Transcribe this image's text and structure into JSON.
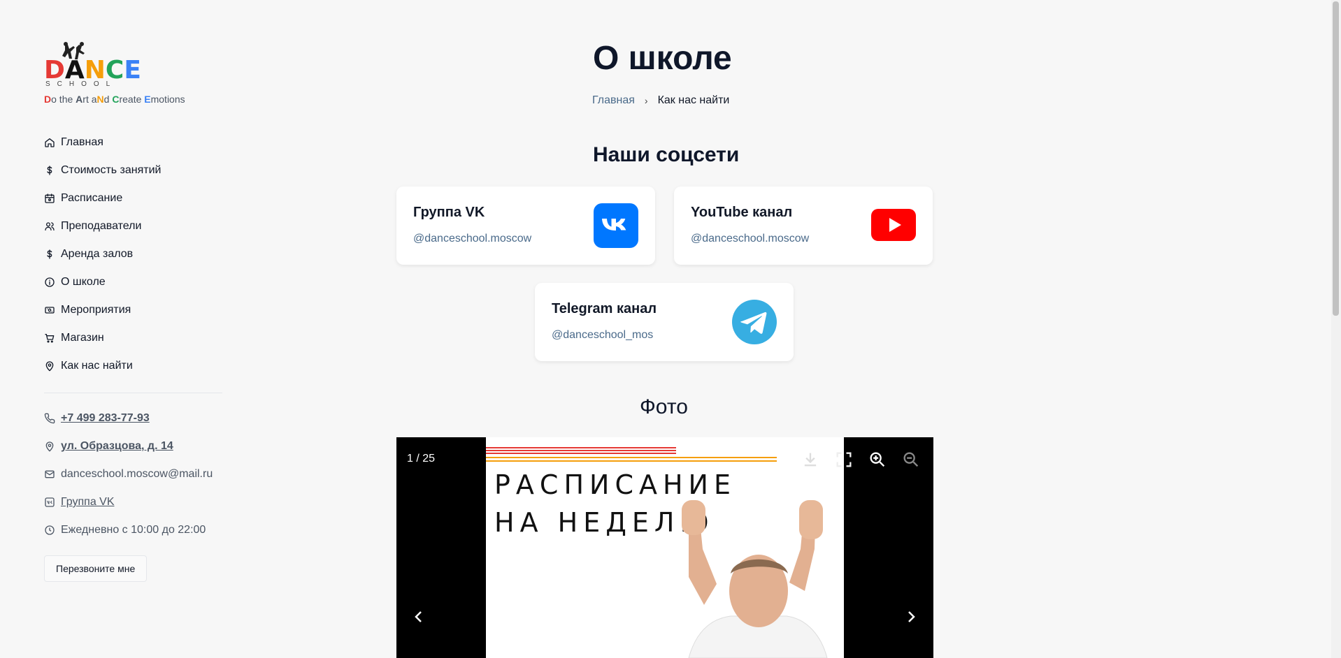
{
  "brand": {
    "logo_text": "DANCE",
    "logo_sub": "SCHOOL",
    "tagline_parts": [
      {
        "t": "D",
        "c": "#e53935",
        "b": true
      },
      {
        "t": "o the ",
        "c": "#4b5563",
        "b": false
      },
      {
        "t": "A",
        "c": "#4b5563",
        "b": true
      },
      {
        "t": "rt a",
        "c": "#4b5563",
        "b": false
      },
      {
        "t": "N",
        "c": "#f59e0b",
        "b": true
      },
      {
        "t": "d ",
        "c": "#4b5563",
        "b": false
      },
      {
        "t": "C",
        "c": "#22a35a",
        "b": true
      },
      {
        "t": "reate ",
        "c": "#4b5563",
        "b": false
      },
      {
        "t": "E",
        "c": "#3b82f6",
        "b": true
      },
      {
        "t": "motions",
        "c": "#4b5563",
        "b": false
      }
    ]
  },
  "nav": [
    {
      "label": "Главная",
      "icon": "home-icon"
    },
    {
      "label": "Стоимость занятий",
      "icon": "dollar-icon"
    },
    {
      "label": "Расписание",
      "icon": "calendar-icon"
    },
    {
      "label": "Преподаватели",
      "icon": "users-icon"
    },
    {
      "label": "Аренда залов",
      "icon": "dollar-icon"
    },
    {
      "label": "О школе",
      "icon": "info-icon"
    },
    {
      "label": "Мероприятия",
      "icon": "ticket-icon"
    },
    {
      "label": "Магазин",
      "icon": "cart-icon"
    },
    {
      "label": "Как нас найти",
      "icon": "map-pin-icon"
    }
  ],
  "contacts": {
    "phone": "+7 499 283-77-93",
    "address": "ул. Образцова, д. 14",
    "email": "danceschool.moscow@mail.ru",
    "vk": "Группа VK",
    "hours": "Ежедневно с 10:00 до 22:00"
  },
  "callback_label": "Перезвоните мне",
  "page": {
    "title": "О школе",
    "breadcrumb_home": "Главная",
    "breadcrumb_current": "Как нас найти",
    "social_heading": "Наши соцсети",
    "photo_heading": "Фото"
  },
  "socials": [
    {
      "name": "Группа VK",
      "handle": "@danceschool.moscow",
      "icon": "vk-icon",
      "color": "#0077ff"
    },
    {
      "name": "YouTube канал",
      "handle": "@danceschool.moscow",
      "icon": "youtube-icon",
      "color": "#ff0000"
    },
    {
      "name": "Telegram канал",
      "handle": "@danceschool_mos",
      "icon": "telegram-icon",
      "color": "#37aee2"
    }
  ],
  "gallery": {
    "counter": "1 / 25",
    "slide_line1": "РАСПИСАНИЕ",
    "slide_line2": "НА НЕДЕЛЮ"
  },
  "colors": {
    "accent_link": "#4a6a8a",
    "stripe_red": "#e53935",
    "stripe_orange": "#f59e0b"
  }
}
